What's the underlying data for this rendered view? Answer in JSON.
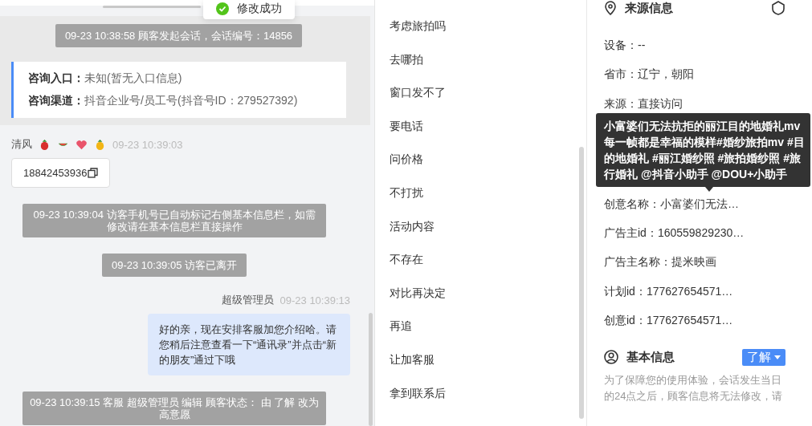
{
  "toast": {
    "text": "修改成功"
  },
  "chat": {
    "session_start": {
      "notice": "09-23 10:38:58 顾客发起会话，会话编号：14856",
      "rows": [
        {
          "label": "咨询入口：",
          "value": "未知(暂无入口信息)"
        },
        {
          "label": "咨询渠道：",
          "value": "抖音企业号/员工号(抖音号ID：279527392)"
        }
      ]
    },
    "messages": [
      {
        "kind": "visitor",
        "sender": "清风",
        "time": "09-23 10:39:03",
        "text": "18842453936"
      },
      {
        "kind": "system",
        "wide": true,
        "text": "09-23 10:39:04 访客手机号已自动标记右侧基本信息栏，如需修改请在基本信息栏直接操作"
      },
      {
        "kind": "system",
        "wide": false,
        "text": "09-23 10:39:05 访客已离开"
      },
      {
        "kind": "agent",
        "sender": "超级管理员",
        "time": "09-23 10:39:13",
        "text": "好的亲，现在安排客服加您介绍哈。请您稍后注意查看一下“通讯录”并点击“新的朋友”通过下哦"
      },
      {
        "kind": "system",
        "wide": true,
        "text": "09-23 10:39:15 客服 超级管理员 编辑 顾客状态： 由 了解 改为高意愿"
      }
    ]
  },
  "quick_replies": [
    "考虑旅拍吗",
    "去哪拍",
    "窗口发不了",
    "要电话",
    "问价格",
    "不打扰",
    "活动内容",
    "不存在",
    "对比再决定",
    "再追",
    "让加客服",
    "拿到联系后"
  ],
  "source_info": {
    "title": "来源信息",
    "rows": [
      "设备：--",
      "省市：辽宁，朝阳",
      "来源：直接访问"
    ],
    "more_rows": [
      "创意名称：小富婆们无法…",
      "广告主id：160559829230…",
      "广告主名称：提米映画",
      "计划id：177627654571…",
      "创意id：177627654571…"
    ],
    "tooltip": {
      "text": "小富婆们无法抗拒的丽江目的地婚礼mv 每一帧都是幸福的模样#婚纱旅拍mv #目的地婚礼 #丽江婚纱照 #旅拍婚纱照 #旅行婚礼 @抖音小助手 @DOU+小助手"
    }
  },
  "basic_info": {
    "title": "基本信息",
    "status": "了解",
    "notice": "为了保障您的使用体验，会话发生当日的24点之后，顾客信息将无法修改，请"
  }
}
